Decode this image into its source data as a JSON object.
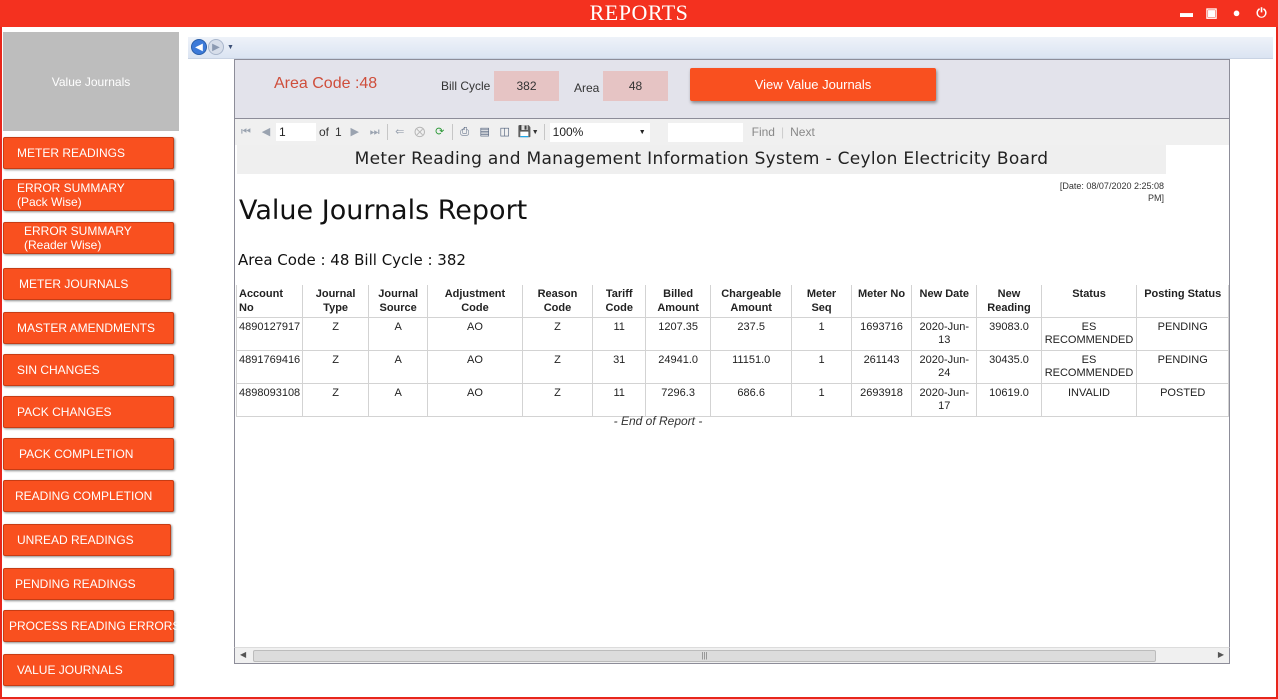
{
  "window": {
    "title": "REPORTS",
    "controls": [
      "minimize",
      "maximize",
      "user",
      "power"
    ]
  },
  "sidebar": {
    "header": "Value Journals",
    "items": [
      {
        "label": "METER READINGS",
        "sub": ""
      },
      {
        "label": "ERROR SUMMARY",
        "sub": "(Pack Wise)"
      },
      {
        "label": "ERROR SUMMARY",
        "sub": "(Reader Wise)"
      },
      {
        "label": "METER JOURNALS",
        "sub": ""
      },
      {
        "label": "MASTER AMENDMENTS",
        "sub": ""
      },
      {
        "label": "SIN CHANGES",
        "sub": ""
      },
      {
        "label": "PACK CHANGES",
        "sub": ""
      },
      {
        "label": "PACK COMPLETION",
        "sub": ""
      },
      {
        "label": "READING COMPLETION",
        "sub": ""
      },
      {
        "label": "UNREAD READINGS",
        "sub": ""
      },
      {
        "label": "PENDING READINGS",
        "sub": ""
      },
      {
        "label": "PROCESS READING ERRORS",
        "sub": ""
      },
      {
        "label": "VALUE JOURNALS",
        "sub": ""
      }
    ]
  },
  "params": {
    "area_code_label": "Area Code :48",
    "bill_cycle_label": "Bill Cycle",
    "bill_cycle_value": "382",
    "area_label": "Area",
    "area_value": "48",
    "view_button": "View Value Journals"
  },
  "toolbar": {
    "page": "1",
    "of_label": "of",
    "total_pages": "1",
    "zoom": "100%",
    "find_label": "Find",
    "next_label": "Next"
  },
  "report": {
    "header": "Meter Reading and Management Information System - Ceylon Electricity Board",
    "date_line1": "[Date: 08/07/2020 2:25:08",
    "date_line2": "PM]",
    "title": "Value Journals Report",
    "subtitle": "Area Code : 48 Bill Cycle : 382",
    "columns": [
      {
        "line1": "Account",
        "line2": "No"
      },
      {
        "line1": "Journal",
        "line2": "Type"
      },
      {
        "line1": "Journal",
        "line2": "Source"
      },
      {
        "line1": "Adjustment",
        "line2": "Code"
      },
      {
        "line1": "Reason",
        "line2": "Code"
      },
      {
        "line1": "Tariff",
        "line2": "Code"
      },
      {
        "line1": "Billed",
        "line2": "Amount"
      },
      {
        "line1": "Chargeable",
        "line2": "Amount"
      },
      {
        "line1": "Meter",
        "line2": "Seq"
      },
      {
        "line1": "Meter No",
        "line2": ""
      },
      {
        "line1": "New Date",
        "line2": ""
      },
      {
        "line1": "New",
        "line2": "Reading"
      },
      {
        "line1": "Status",
        "line2": ""
      },
      {
        "line1": "Posting Status",
        "line2": ""
      }
    ],
    "rows": [
      [
        "4890127917",
        "Z",
        "A",
        "AO",
        "Z",
        "11",
        "1207.35",
        "237.5",
        "1",
        "1693716",
        "2020-Jun-13",
        "39083.0",
        "ES RECOMMENDED",
        "PENDING"
      ],
      [
        "4891769416",
        "Z",
        "A",
        "AO",
        "Z",
        "31",
        "24941.0",
        "11151.0",
        "1",
        "261143",
        "2020-Jun-24",
        "30435.0",
        "ES RECOMMENDED",
        "PENDING"
      ],
      [
        "4898093108",
        "Z",
        "A",
        "AO",
        "Z",
        "11",
        "7296.3",
        "686.6",
        "1",
        "2693918",
        "2020-Jun-17",
        "10619.0",
        "INVALID",
        "POSTED"
      ]
    ],
    "end_text": "- End of Report -"
  },
  "colors": {
    "accent": "#f9501f",
    "title_bar": "#f4311f",
    "param_box": "#e6c4c4",
    "area_code_text": "#cf4e3b"
  }
}
